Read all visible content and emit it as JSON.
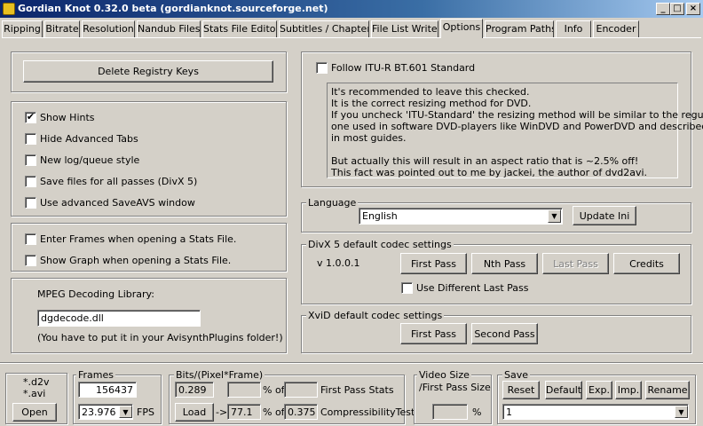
{
  "window": {
    "title": "Gordian Knot 0.32.0 beta (gordianknot.sourceforge.net)",
    "minimize": "_",
    "maximize": "□",
    "close": "×"
  },
  "tabs": [
    {
      "label": "Ripping"
    },
    {
      "label": "Bitrate"
    },
    {
      "label": "Resolution"
    },
    {
      "label": "Nandub Files"
    },
    {
      "label": "Stats File Editor"
    },
    {
      "label": "Subtitles / Chapters"
    },
    {
      "label": "File List Writer"
    },
    {
      "label": "Options"
    },
    {
      "label": "Program Paths"
    },
    {
      "label": "Info"
    },
    {
      "label": "Encoder"
    }
  ],
  "options": {
    "delete_registry": "Delete Registry Keys",
    "show_hints": "Show Hints",
    "hide_advanced": "Hide Advanced Tabs",
    "new_log": "New log/queue style",
    "save_files": "Save files for all passes (DivX 5)",
    "advanced_saveavs": "Use advanced SaveAVS window",
    "enter_frames": "Enter Frames when opening a Stats File.",
    "show_graph": "Show Graph when opening a Stats File.",
    "mpeg_label": "MPEG Decoding Library:",
    "mpeg_value": "dgdecode.dll",
    "mpeg_note": "(You have to put it in your AvisynthPlugins folder!)",
    "follow_itu": "Follow ITU-R BT.601 Standard",
    "itu_text": [
      "It's recommended  to leave this checked.",
      "It is the correct resizing method for DVD.",
      "If you uncheck 'ITU-Standard' the resizing method will be similar to the regular",
      "one used in software DVD-players like WinDVD and PowerDVD and described",
      "in most guides.",
      "",
      "But actually this will result in an aspect ratio that is ~2.5% off!",
      "This fact was pointed out to me by jackei, the author of dvd2avi."
    ],
    "language_label": "Language",
    "language_value": "English",
    "update_ini": "Update Ini",
    "divx_label": "DivX 5 default codec settings",
    "divx_version": "v 1.0.0.1",
    "divx_first": "First Pass",
    "divx_nth": "Nth Pass",
    "divx_last": "Last Pass",
    "divx_credits": "Credits",
    "use_diff_last": "Use Different Last Pass",
    "xvid_label": "XviD default codec settings",
    "xvid_first": "First Pass",
    "xvid_second": "Second Pass"
  },
  "bottom": {
    "ext_d2v": "*.d2v",
    "ext_avi": "*.avi",
    "open": "Open",
    "frames_label": "Frames",
    "frames_value": "156437",
    "fps_value": "23.976",
    "fps_label": "FPS",
    "bits_label": "Bits/(Pixel*Frame)",
    "bits_value": "0.289",
    "pct_of_1": "% of",
    "first_pass_stats": "First Pass Stats",
    "load": "Load",
    "arrow": "->",
    "comp_pct": "77.1",
    "pct_of_2": "% of",
    "comp_value": "0.375",
    "compress_test": "CompressibilityTest",
    "video_size_label": "Video Size",
    "first_pass_size": "/First Pass Size",
    "pct": "%",
    "save_label": "Save",
    "reset": "Reset",
    "default": "Default",
    "exp": "Exp.",
    "imp": "Imp.",
    "rename": "Rename",
    "save_value": "1"
  },
  "checks": {
    "show_hints": true,
    "hide_advanced": false,
    "new_log": false,
    "save_files": false,
    "advanced_saveavs": false,
    "enter_frames": false,
    "show_graph": false,
    "follow_itu": false,
    "use_diff_last": false
  },
  "icons": {
    "check": "✔",
    "dropdown": "▼"
  }
}
